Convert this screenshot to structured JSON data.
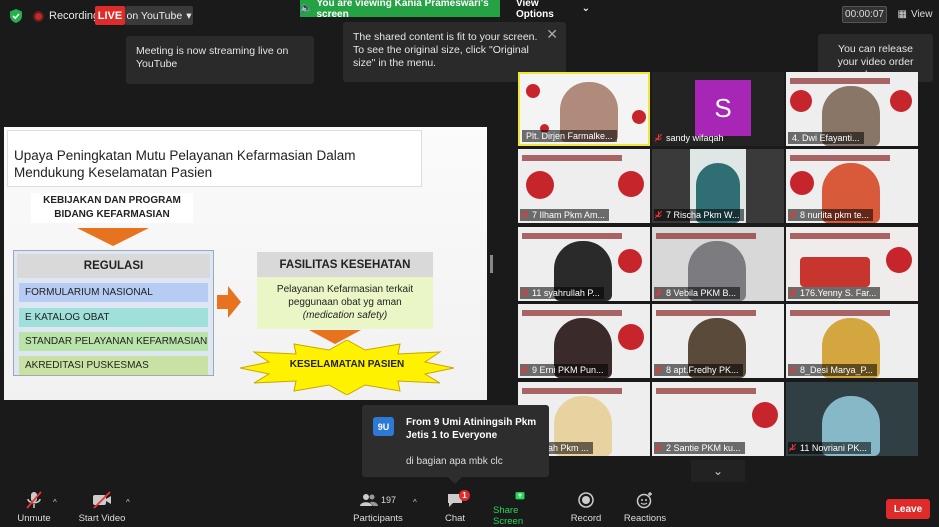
{
  "topbar": {
    "recording_label": "Recording",
    "live_label": "LIVE",
    "stream_target": "on YouTube",
    "viewing_banner": "You are viewing Kania Prameswari's screen",
    "view_options": "View Options",
    "timer": "00:00:07",
    "view_label": "View"
  },
  "tooltips": {
    "streaming": "Meeting is now streaming live on YouTube",
    "fit_screen": "The shared content is fit to your screen. To see the original size, click \"Original size\" in the menu.",
    "release_order": "You can release your video order here"
  },
  "slide": {
    "title": "Upaya Peningkatan Mutu Pelayanan Kefarmasian Dalam Mendukung Keselamatan Pasien",
    "policy_line1": "KEBIJAKAN DAN PROGRAM",
    "policy_line2": "BIDANG KEFARMASIAN",
    "regulasi_title": "REGULASI",
    "regulasi_items": [
      "FORMULARIUM NASIONAL",
      "E KATALOG OBAT",
      "STANDAR PELAYANAN KEFARMASIAN",
      "AKREDITASI PUSKESMAS"
    ],
    "facility_title": "FASILITAS KESEHATAN",
    "facility_text": "Pelayanan Kefarmasian terkait peggunaan obat yg aman",
    "facility_text_italic": "(medication safety)",
    "outcome": "KESELAMATAN PASIEN"
  },
  "participants_tiles": [
    {
      "name": "Plt. Dirjen Farmalke...",
      "kind": "video",
      "active": true,
      "muted": false
    },
    {
      "name": "sandy wifaqah",
      "kind": "avatar",
      "avatar_letter": "S",
      "muted": true
    },
    {
      "name": "4. Dwi Efayanti...",
      "kind": "video",
      "muted": false
    },
    {
      "name": "7 Ilham Pkm Am...",
      "kind": "video",
      "muted": true
    },
    {
      "name": "7 Rischa Pkm W...",
      "kind": "video",
      "muted": true
    },
    {
      "name": "8 nurlita pkm te...",
      "kind": "video",
      "muted": true
    },
    {
      "name": "11 syahrullah P...",
      "kind": "video",
      "muted": true
    },
    {
      "name": "8 Vebila PKM B...",
      "kind": "video",
      "muted": true
    },
    {
      "name": "176.Yenny S. Far...",
      "kind": "video",
      "muted": true
    },
    {
      "name": "9 Erni PKM Pun...",
      "kind": "video",
      "muted": true
    },
    {
      "name": "8 apt.Fredhy PK...",
      "kind": "video",
      "muted": true
    },
    {
      "name": "8_Desi Marya_P...",
      "kind": "video",
      "muted": true
    },
    {
      "name": "...usniah Pkm ...",
      "kind": "video",
      "muted": false
    },
    {
      "name": "2 Santie PKM ku...",
      "kind": "video",
      "muted": true
    },
    {
      "name": "11 Novriani PK...",
      "kind": "video",
      "muted": true
    }
  ],
  "chat_popup": {
    "avatar_initials": "9U",
    "from": "From 9 Umi Atiningsih Pkm Jetis 1 to Everyone",
    "message": "di bagian apa mbk clc"
  },
  "toolbar": {
    "unmute": "Unmute",
    "start_video": "Start Video",
    "participants_count": "197",
    "participants": "Participants",
    "chat": "Chat",
    "chat_badge": "1",
    "share_screen": "Share Screen",
    "record": "Record",
    "reactions": "Reactions",
    "leave": "Leave"
  },
  "colors": {
    "live_red": "#e02b2b",
    "viewing_green": "#25a244",
    "share_green": "#23d959",
    "active_speaker": "#f2e63a"
  }
}
